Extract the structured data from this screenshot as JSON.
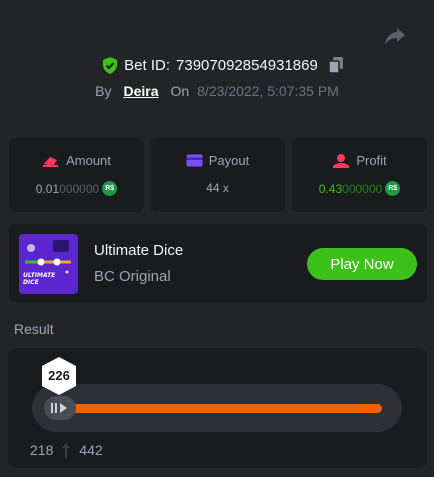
{
  "header": {
    "share_icon": "share-arrow-icon",
    "bet_id_label": "Bet ID:",
    "bet_id": "73907092854931869",
    "verified_icon": "shield-check-icon",
    "copy_icon": "copy-icon"
  },
  "bet_meta": {
    "by_label": "By",
    "user": "Deira",
    "on_label": "On",
    "date": "8/23/2022, 5:07:35 PM"
  },
  "stats": {
    "amount": {
      "label": "Amount",
      "value_strong": "0.01",
      "value_dim": "000000",
      "currency": "R$"
    },
    "payout": {
      "label": "Payout",
      "value": "44 x"
    },
    "profit": {
      "label": "Profit",
      "value_strong": "0.43",
      "value_dim": "000000",
      "currency": "R$"
    }
  },
  "game": {
    "title": "Ultimate Dice",
    "subtitle": "BC Original",
    "thumb_text": "ULTIMATE DICE",
    "play_label": "Play Now"
  },
  "result": {
    "label": "Result",
    "value": "226",
    "range_low": "218",
    "range_high": "442"
  },
  "colors": {
    "background": "#232428",
    "card": "#1a1b1e",
    "accent_green": "#3bc117",
    "bar_orange": "#ed6300"
  }
}
